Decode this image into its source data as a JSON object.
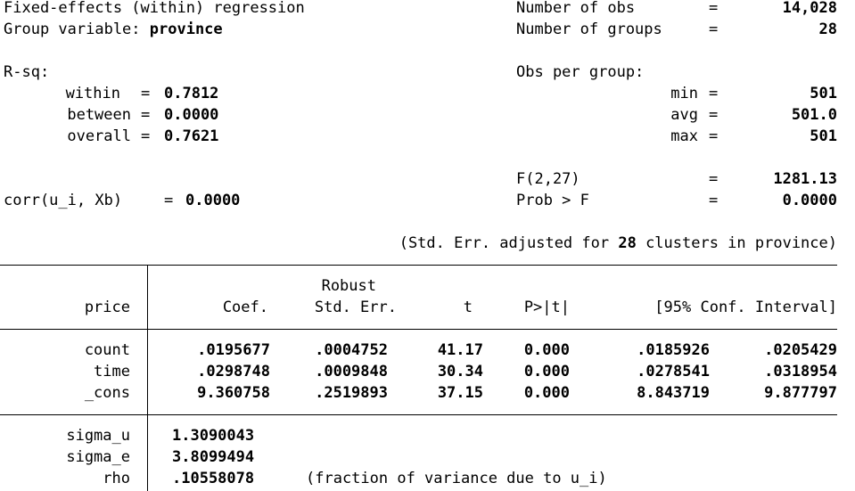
{
  "header": {
    "title": "Fixed-effects (within) regression",
    "group_var_label": "Group variable: ",
    "group_var_value": "province",
    "nobs_label": "Number of obs",
    "nobs_value": "14,028",
    "ngroups_label": "Number of groups",
    "ngroups_value": "28",
    "eq": "="
  },
  "rsq": {
    "label": "R-sq:",
    "within_label": "within",
    "within_value": "0.7812",
    "between_label": "between",
    "between_value": "0.0000",
    "overall_label": "overall",
    "overall_value": "0.7621"
  },
  "obs_per_group": {
    "label": "Obs per group:",
    "min_label": "min",
    "min_value": "501",
    "avg_label": "avg",
    "avg_value": "501.0",
    "max_label": "max",
    "max_value": "501"
  },
  "ftest": {
    "f_label": "F(2,27)",
    "f_value": "1281.13",
    "prob_label": "Prob > F",
    "prob_value": "0.0000"
  },
  "corr": {
    "label": "corr(u_i, Xb)",
    "value": "0.0000"
  },
  "se_note": {
    "prefix": "(Std. Err. adjusted for ",
    "clusters": "28",
    "suffix": " clusters in province)"
  },
  "table": {
    "depvar": "price",
    "col_coef": "Coef.",
    "col_robust": "Robust",
    "col_se": "Std. Err.",
    "col_t": "t",
    "col_p": "P>|t|",
    "col_ci": "[95% Conf. Interval]",
    "rows": [
      {
        "name": "count",
        "coef": ".0195677",
        "se": ".0004752",
        "t": "41.17",
        "p": "0.000",
        "lo": ".0185926",
        "hi": ".0205429"
      },
      {
        "name": "time",
        "coef": ".0298748",
        "se": ".0009848",
        "t": "30.34",
        "p": "0.000",
        "lo": ".0278541",
        "hi": ".0318954"
      },
      {
        "name": "_cons",
        "coef": "9.360758",
        "se": ".2519893",
        "t": "37.15",
        "p": "0.000",
        "lo": "8.843719",
        "hi": "9.877797"
      }
    ]
  },
  "sigma": {
    "sigma_u_label": "sigma_u",
    "sigma_u_value": "1.3090043",
    "sigma_e_label": "sigma_e",
    "sigma_e_value": "3.8099494",
    "rho_label": "rho",
    "rho_value": ".10558078",
    "rho_note": "(fraction of variance due to u_i)"
  }
}
